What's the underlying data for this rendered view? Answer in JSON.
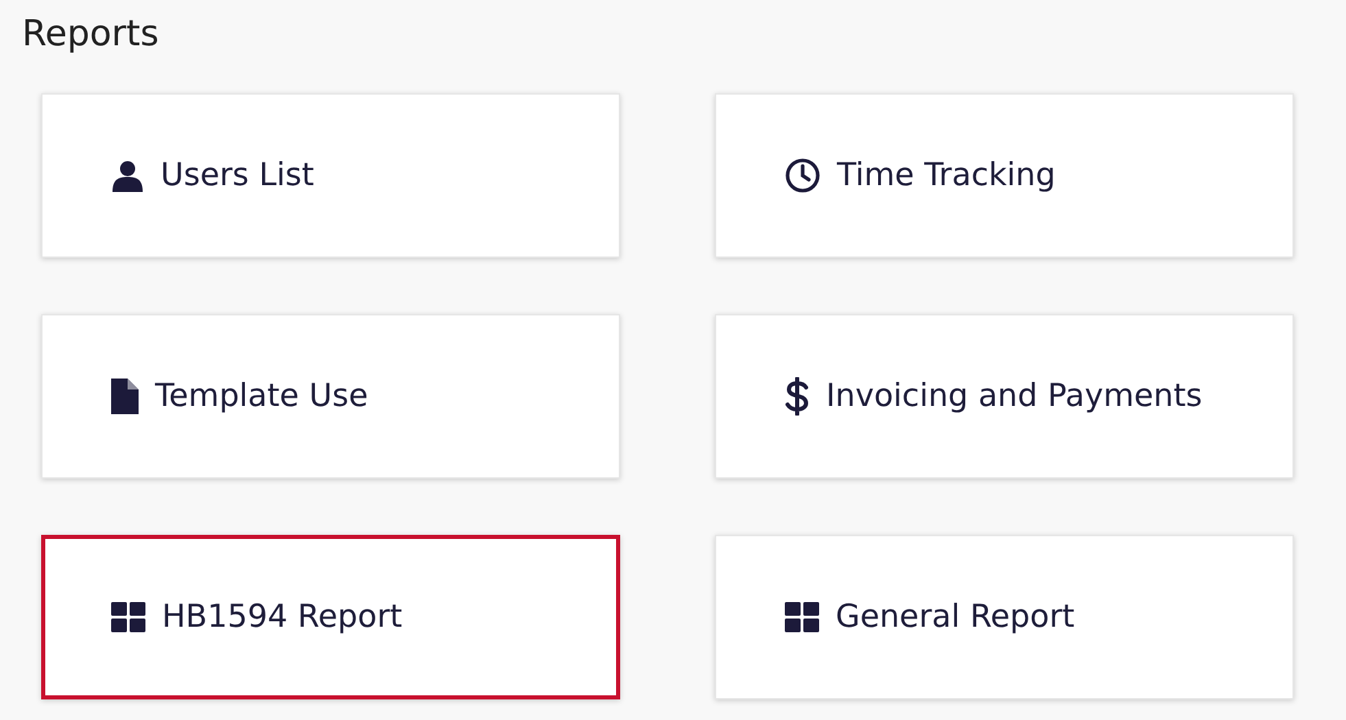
{
  "title": "Reports",
  "cards": [
    {
      "label": "Users List",
      "kind": "user",
      "selected": false
    },
    {
      "label": "Time Tracking",
      "kind": "clock",
      "selected": false
    },
    {
      "label": "Template Use",
      "kind": "file",
      "selected": false
    },
    {
      "label": "Invoicing and Payments",
      "kind": "dollar",
      "selected": false
    },
    {
      "label": "HB1594 Report",
      "kind": "grid",
      "selected": true
    },
    {
      "label": "General Report",
      "kind": "grid",
      "selected": false
    }
  ]
}
